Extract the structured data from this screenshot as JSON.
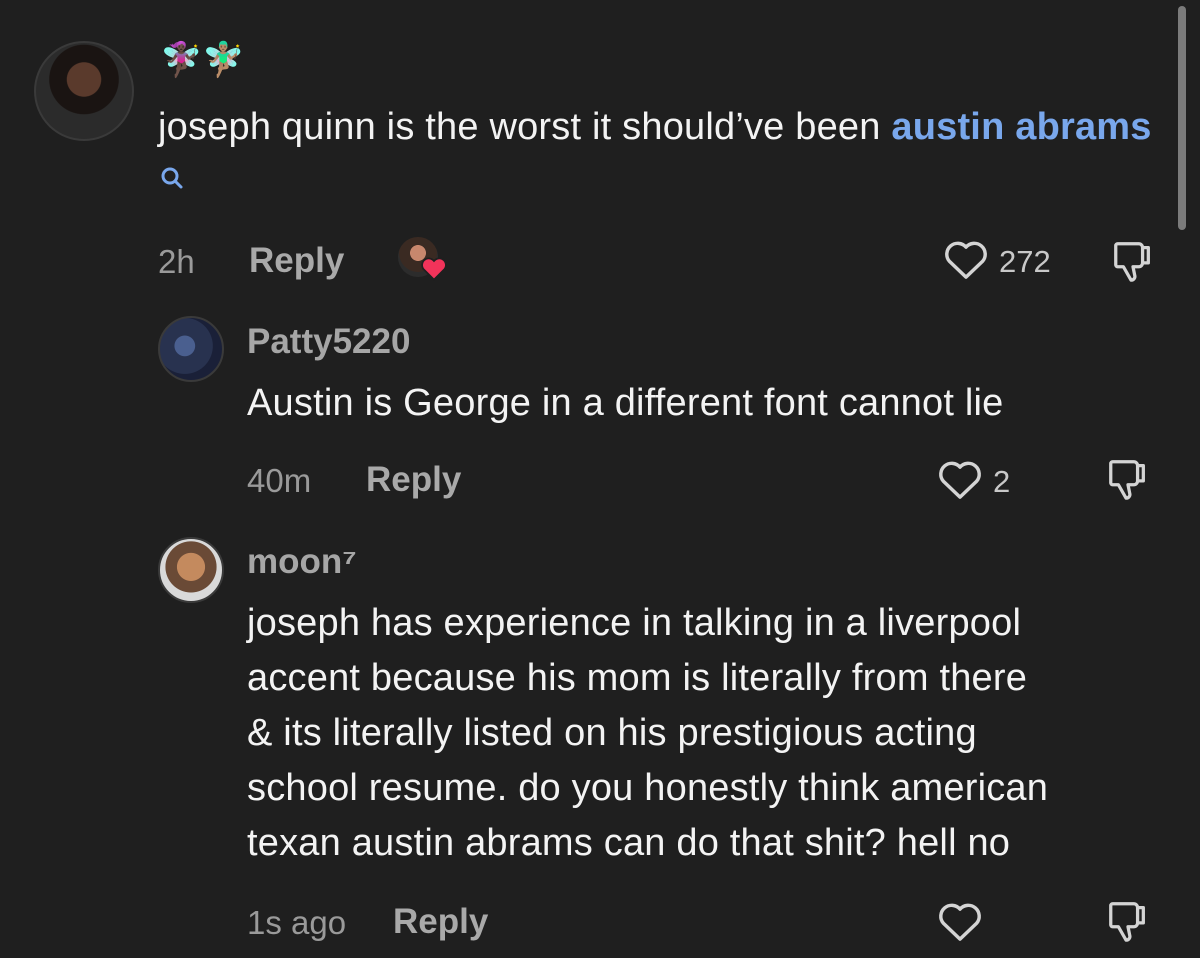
{
  "comments": [
    {
      "username": "🧚🏿‍♀️🧚🏽‍♂️",
      "text_before": "joseph quinn is the worst it should’ve been ",
      "mention": "austin abrams",
      "time": "2h",
      "reply_label": "Reply",
      "likes": "272",
      "creator_liked": true
    },
    {
      "username": "Patty5220",
      "text": "Austin is George in a different font cannot lie",
      "time": "40m",
      "reply_label": "Reply",
      "likes": "2"
    },
    {
      "username": "moon⁷",
      "lines": [
        "joseph has experience in talking in a liverpool",
        "accent because his mom is literally from there",
        "& its literally listed on his prestigious acting",
        "school resume. do you honestly think american",
        "texan austin abrams can do that shit? hell no"
      ],
      "time": "1s ago",
      "reply_label": "Reply",
      "likes": ""
    }
  ],
  "colors": {
    "background": "#1f1f1f",
    "mention": "#79a7ec",
    "heart_badge": "#f2335a"
  },
  "icons": [
    "search-icon",
    "heart-outline-icon",
    "dislike-icon",
    "creator-heart-badge-icon"
  ]
}
